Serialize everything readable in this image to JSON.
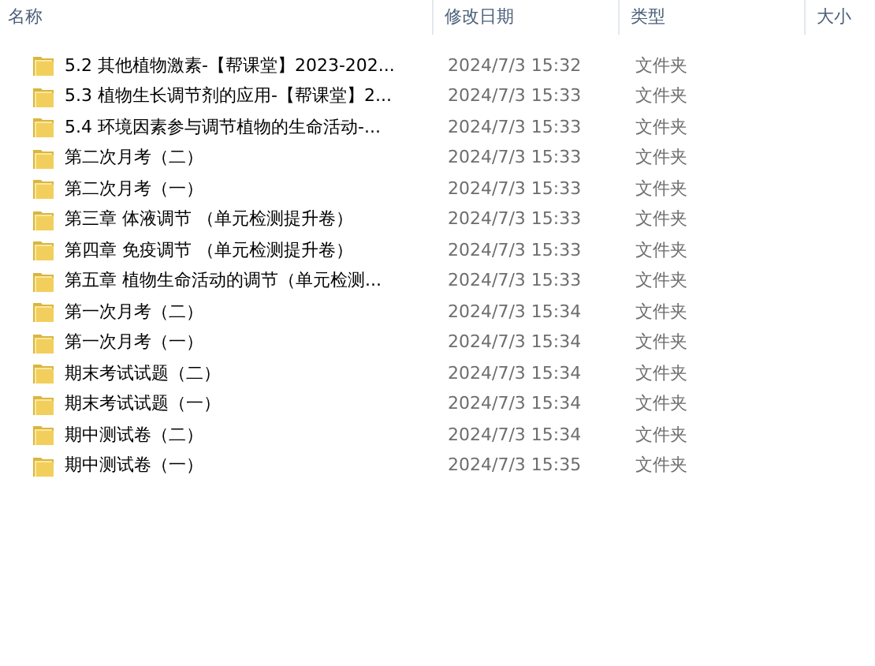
{
  "columns": [
    "名称",
    "修改日期",
    "类型",
    "大小"
  ],
  "rows": [
    {
      "name": "5.2 其他植物激素-【帮课堂】2023-202...",
      "date": "2024/7/3 15:32",
      "type": "文件夹"
    },
    {
      "name": "5.3 植物生长调节剂的应用-【帮课堂】2...",
      "date": "2024/7/3 15:33",
      "type": "文件夹"
    },
    {
      "name": "5.4 环境因素参与调节植物的生命活动-...",
      "date": "2024/7/3 15:33",
      "type": "文件夹"
    },
    {
      "name": "第二次月考（二）",
      "date": "2024/7/3 15:33",
      "type": "文件夹"
    },
    {
      "name": "第二次月考（一）",
      "date": "2024/7/3 15:33",
      "type": "文件夹"
    },
    {
      "name": "第三章 体液调节 （单元检测提升卷）",
      "date": "2024/7/3 15:33",
      "type": "文件夹"
    },
    {
      "name": "第四章 免疫调节 （单元检测提升卷）",
      "date": "2024/7/3 15:33",
      "type": "文件夹"
    },
    {
      "name": "第五章 植物生命活动的调节（单元检测...",
      "date": "2024/7/3 15:33",
      "type": "文件夹"
    },
    {
      "name": "第一次月考（二）",
      "date": "2024/7/3 15:34",
      "type": "文件夹"
    },
    {
      "name": "第一次月考（一）",
      "date": "2024/7/3 15:34",
      "type": "文件夹"
    },
    {
      "name": "期末考试试题（二）",
      "date": "2024/7/3 15:34",
      "type": "文件夹"
    },
    {
      "name": "期末考试试题（一）",
      "date": "2024/7/3 15:34",
      "type": "文件夹"
    },
    {
      "name": "期中测试卷（二）",
      "date": "2024/7/3 15:34",
      "type": "文件夹"
    },
    {
      "name": "期中测试卷（一）",
      "date": "2024/7/3 15:35",
      "type": "文件夹"
    }
  ]
}
